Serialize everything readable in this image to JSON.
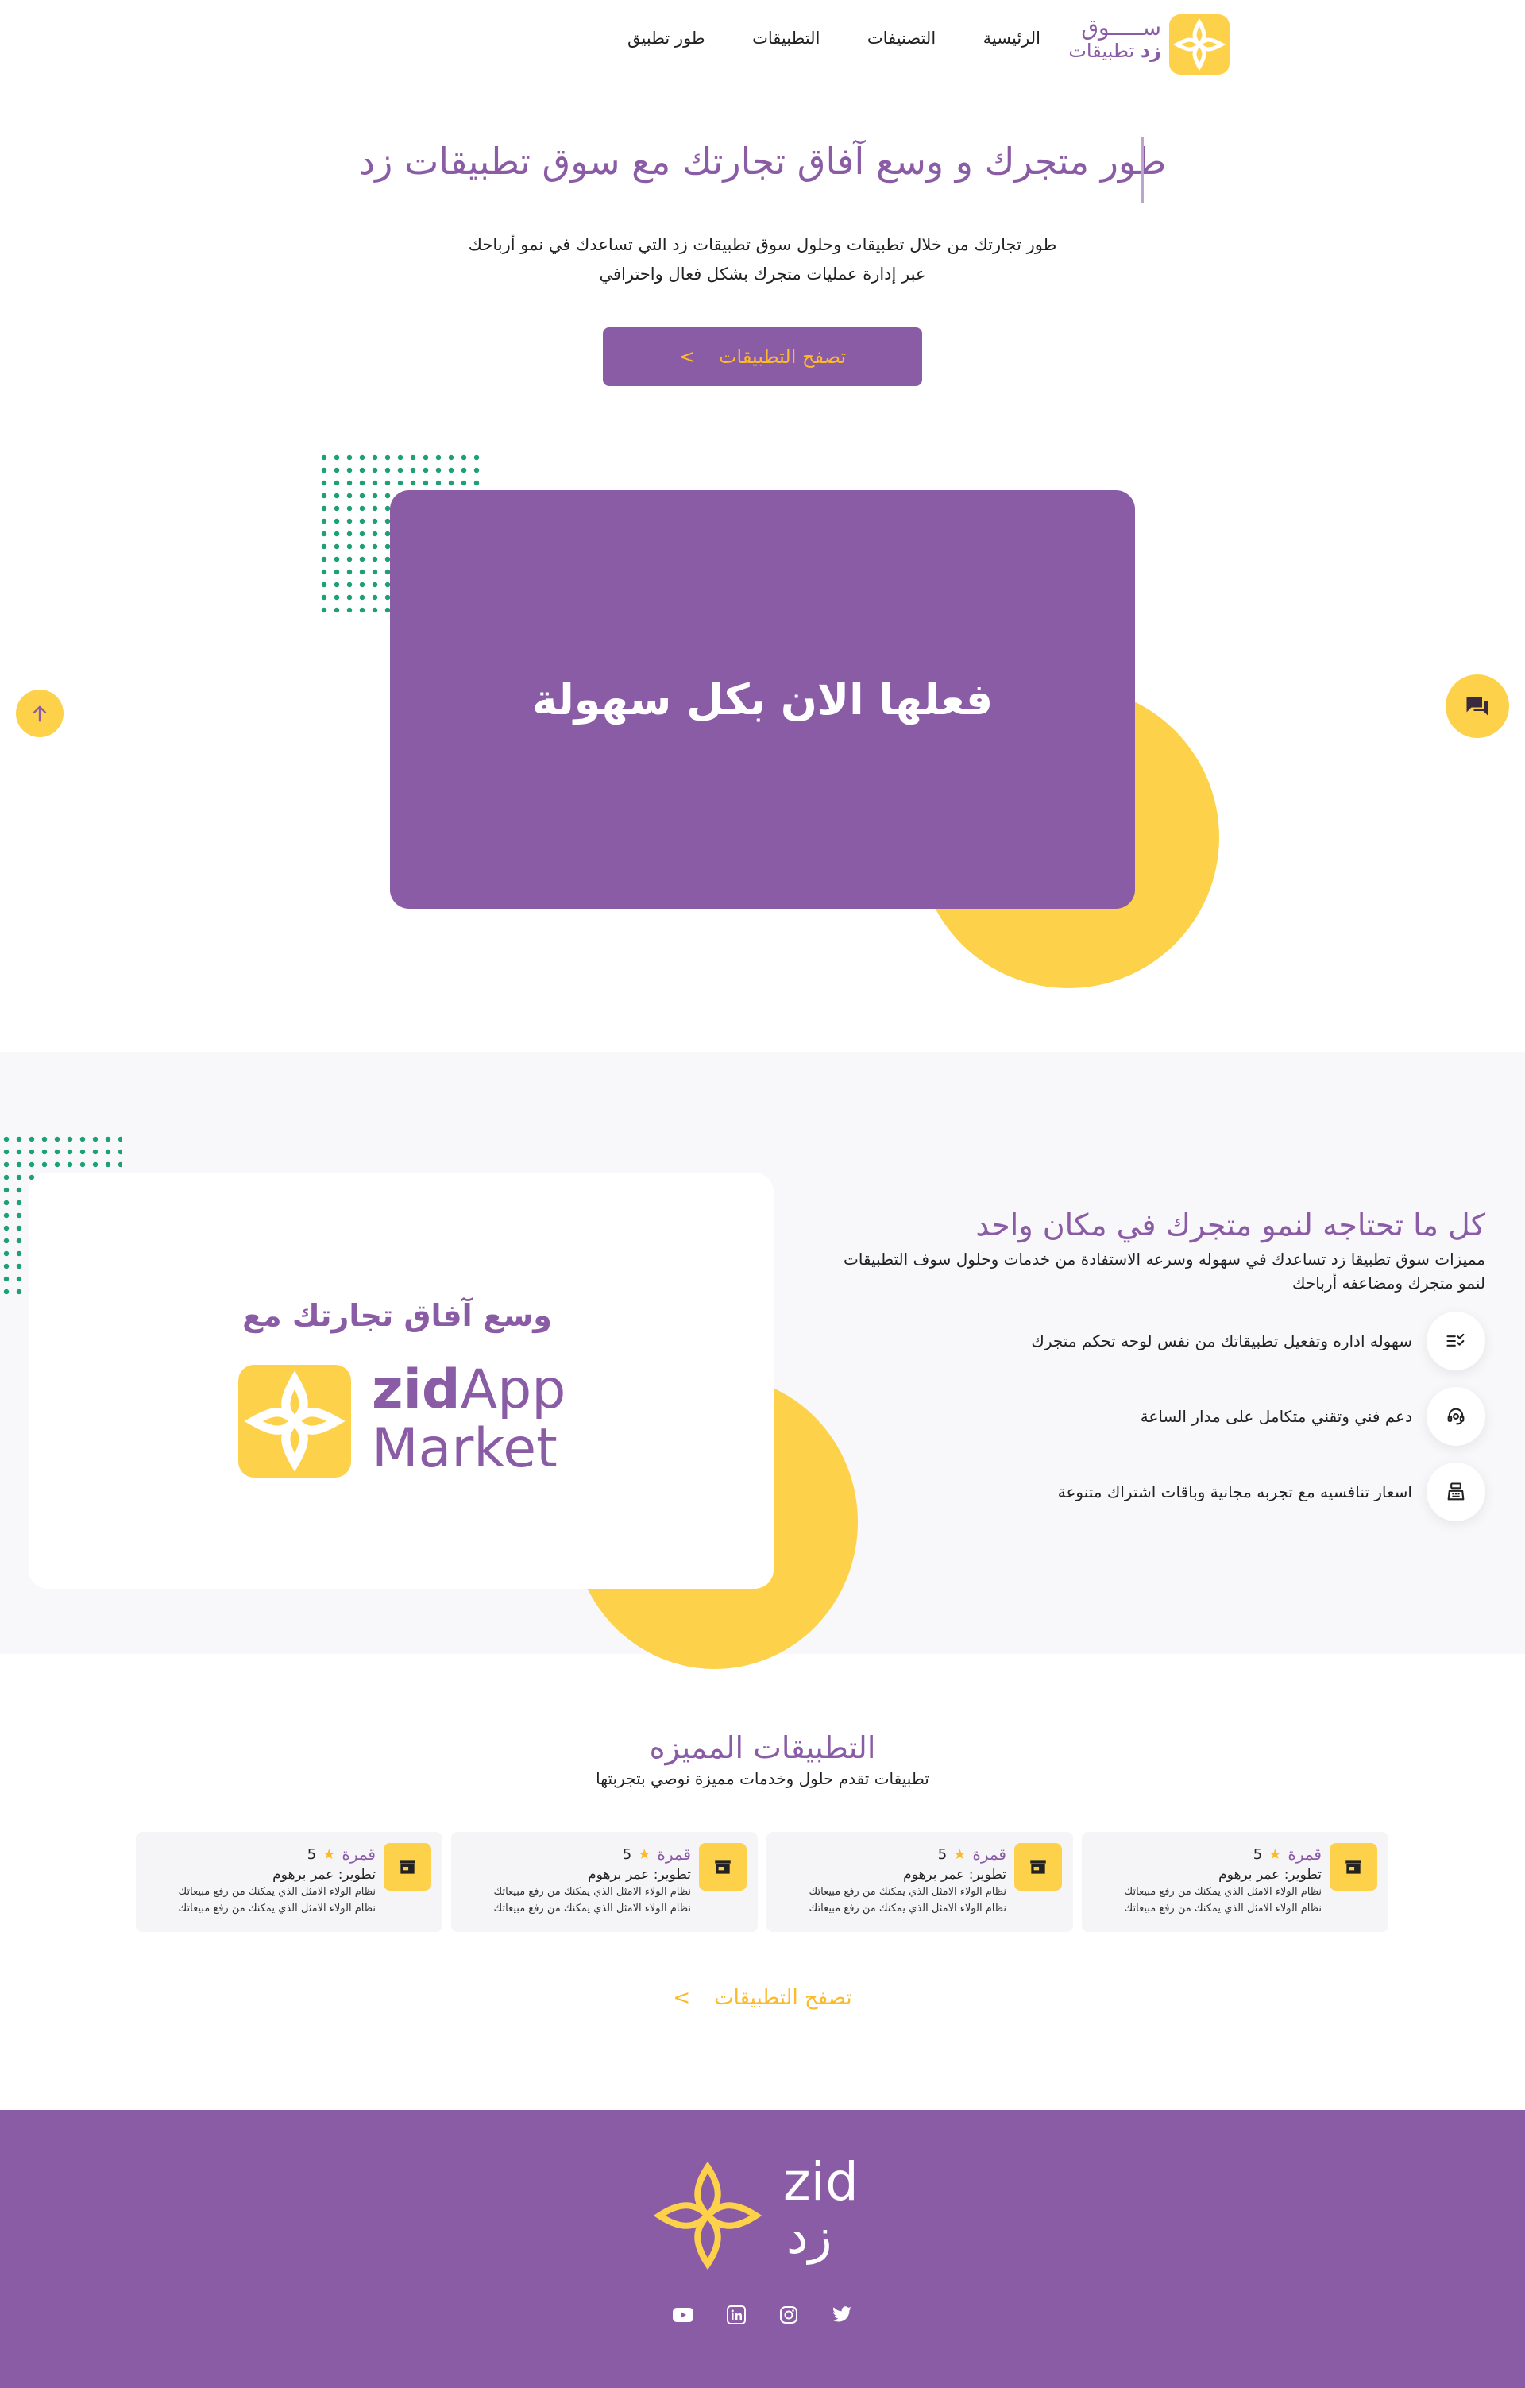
{
  "nav": {
    "logo_line1": "ســـــوق",
    "logo_line2_a": "تطبيقات",
    "logo_line2_b": "زد",
    "links": [
      "الرئيسية",
      "التصنيفات",
      "التطبيقات",
      "طور تطبيق"
    ]
  },
  "hero": {
    "title": "طور متجرك و وسع آفاق تجارتك مع سوق تطبيقات زد",
    "subtitle_line1": "طور تجارتك من خلال تطبيقات وحلول سوق تطبيقات زد التي تساعدك في نمو أرباحك",
    "subtitle_line2": "عبر إدارة عمليات متجرك بشكل فعال واحترافي",
    "button_label": "تصفح التطبيقات",
    "button_arrow": ">",
    "card_text": "فعلها الان بكل سهولة"
  },
  "features": {
    "card_title": "وسع آفاق تجارتك مع",
    "market_logo": {
      "zid": "zid",
      "app": "App",
      "market": "Market"
    },
    "title": "كل ما تحتاجه لنمو متجرك في مكان واحد",
    "desc_line1": "مميزات سوق تطبيقا زد تساعدك في سهوله وسرعه الاستفادة من خدمات وحلول سوف التطبيقات",
    "desc_line2": "لنمو متجرك ومضاعفه أرباحك",
    "items": [
      {
        "text": "سهوله اداره وتفعيل تطبيقاتك من نفس لوحه تحكم متجرك",
        "icon": "checklist-icon"
      },
      {
        "text": "دعم فني وتقني متكامل على مدار الساعة",
        "icon": "support-agent-icon"
      },
      {
        "text": "اسعار تنافسيه مع تجربه مجانية وباقات اشتراك متنوعة",
        "icon": "cash-register-icon"
      }
    ]
  },
  "apps": {
    "title": "التطبيقات المميزه",
    "subtitle": "تطبيقات تقدم حلول وخدمات مميزة نوصي بتجربتها",
    "cards": [
      {
        "name": "قمرة",
        "rating": "5",
        "dev": "تطوير: عمر برهوم",
        "desc1": "نظام الولاء الامثل الذي يمكنك من رفع مبيعاتك",
        "desc2": "نظام الولاء الامثل الذي يمكنك من رفع مبيعاتك"
      },
      {
        "name": "قمرة",
        "rating": "5",
        "dev": "تطوير: عمر برهوم",
        "desc1": "نظام الولاء الامثل الذي يمكنك من رفع مبيعاتك",
        "desc2": "نظام الولاء الامثل الذي يمكنك من رفع مبيعاتك"
      },
      {
        "name": "قمرة",
        "rating": "5",
        "dev": "تطوير: عمر برهوم",
        "desc1": "نظام الولاء الامثل الذي يمكنك من رفع مبيعاتك",
        "desc2": "نظام الولاء الامثل الذي يمكنك من رفع مبيعاتك"
      },
      {
        "name": "قمرة",
        "rating": "5",
        "dev": "تطوير: عمر برهوم",
        "desc1": "نظام الولاء الامثل الذي يمكنك من رفع مبيعاتك",
        "desc2": "نظام الولاء الامثل الذي يمكنك من رفع مبيعاتك"
      }
    ],
    "browse_label": "تصفح التطبيقات",
    "browse_arrow": ">"
  },
  "footer": {
    "logo_en": "zid",
    "logo_ar": "زد",
    "socials": [
      "youtube-icon",
      "linkedin-icon",
      "instagram-icon",
      "twitter-icon"
    ]
  },
  "colors": {
    "purple": "#8B5CA6",
    "yellow": "#FDD24A",
    "orange_text": "#FDB927",
    "dots_green": "#1EA074",
    "section_bg": "#F8F8FA"
  }
}
